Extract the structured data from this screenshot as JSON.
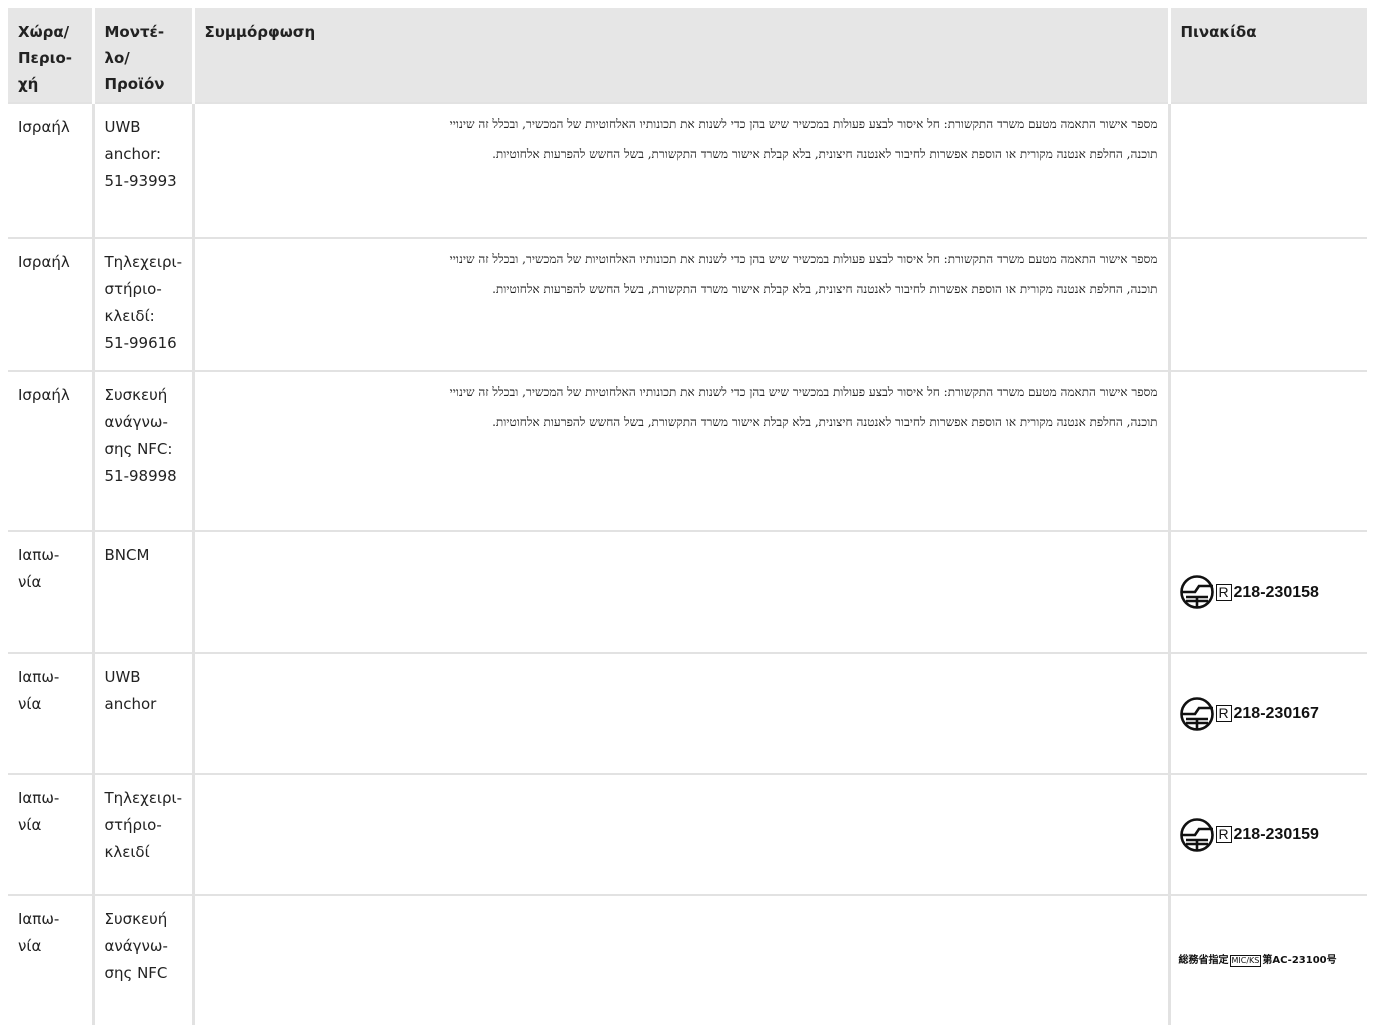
{
  "header": {
    "country": "Χώρα/ Περιο-χή",
    "model": "Μοντέ-λο/ Προϊόν",
    "compliance": "Συμμόρφωση",
    "label": "Πινακίδα"
  },
  "israel_text": {
    "line1": "מספר אישור התאמה מטעם משרד התקשורת: חל איסור לבצע פעולות במכשיר שיש בהן כדי לשנות את תכונותיו האלחוטיות של המכשיר, ובכלל זה שינויי",
    "line2": "תוכנה, החלפת אנטנה מקורית או הוספת אפשרות לחיבור לאנטנה חיצונית, בלא קבלת אישור משרד התקשורת, בשל החשש להפרעות אלחוטיות."
  },
  "rows": [
    {
      "country": "Ισραήλ",
      "model": "UWB anchor: 51-93993"
    },
    {
      "country": "Ισραήλ",
      "model": "Τηλεχειρι-στήριο-κλειδί: 51-99616"
    },
    {
      "country": "Ισραήλ",
      "model": "Συσκευή ανάγνω-σης NFC: 51-98998"
    },
    {
      "country": "Ιαπω-νία",
      "model": "BNCM",
      "label_r": "R",
      "label_num": "218-230158"
    },
    {
      "country": "Ιαπω-νία",
      "model": "UWB anchor",
      "label_r": "R",
      "label_num": "218-230167"
    },
    {
      "country": "Ιαπω-νία",
      "model": "Τηλεχειρι-στήριο-κλειδί",
      "label_r": "R",
      "label_num": "218-230159"
    },
    {
      "country": "Ιαπω-νία",
      "model": "Συσκευή ανάγνω-σης NFC",
      "label_jp1": "総務省指定",
      "label_mic": "MIC/KS",
      "label_jp2": "第AC-23100号"
    }
  ],
  "icons": {
    "giteki": "giteki-mark-icon"
  },
  "colors": {
    "header_bg": "#e6e6e6",
    "grid": "#e2e2e2"
  }
}
